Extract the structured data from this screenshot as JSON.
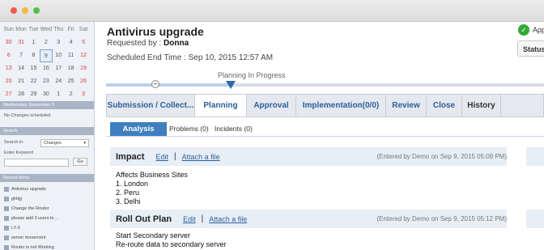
{
  "calendar": {
    "headers": [
      "Sun",
      "Mon",
      "Tue",
      "Wed",
      "Thu",
      "Fri",
      "Sat"
    ],
    "weeks": [
      [
        "30",
        "31",
        "1",
        "2",
        "3",
        "4",
        "5"
      ],
      [
        "6",
        "7",
        "8",
        "9",
        "10",
        "11",
        "12"
      ],
      [
        "13",
        "14",
        "15",
        "16",
        "17",
        "18",
        "19"
      ],
      [
        "20",
        "21",
        "22",
        "23",
        "24",
        "25",
        "26"
      ],
      [
        "27",
        "28",
        "29",
        "30",
        "1",
        "2",
        "3"
      ]
    ],
    "selected": "9"
  },
  "sidebar": {
    "date_header": "Wednesday, September 9",
    "no_changes": "No Changes scheduled",
    "search_header": "Search",
    "search_in_label": "Search in:",
    "search_in_value": "Changes",
    "keyword_label": "Enter Keyword",
    "go_label": "Go",
    "recent_header": "Recent Items",
    "recent_items": [
      "Antivirus upgrade",
      "ghhjjj",
      "Change the Router",
      "please add 3 users to ...",
      "LY-3",
      "server movement",
      "Router is not Working"
    ]
  },
  "header": {
    "title": "Antivirus upgrade",
    "requested_label": "Requested by : ",
    "requested_by": "Donna",
    "scheduled": "Scheduled End Time : Sep 10, 2015 12:57 AM",
    "approved_label": "App",
    "status_label": "Status"
  },
  "progress": {
    "label": "Planning In Progress",
    "fraction": 0.29
  },
  "tabs": [
    "Submission / Collect...",
    "Planning",
    "Approval",
    "Implementation(0/0)",
    "Review",
    "Close",
    "History"
  ],
  "subtabs": {
    "analysis": "Analysis",
    "problems": "Problems (0)",
    "incidents": "Incidents (0)"
  },
  "panels": [
    {
      "title": "Impact",
      "edit": "Edit",
      "sep": "|",
      "attach": "Attach a file",
      "meta": "(Entered by Demo on Sep 9, 2015 05:09 PM)",
      "lines": [
        "Affects Business Sites",
        "1. London",
        "2. Peru",
        "3. Delhi"
      ]
    },
    {
      "title": "Roll Out Plan",
      "edit": "Edit",
      "sep": "|",
      "attach": "Attach a file",
      "meta": "(Entered by Demo on Sep 9, 2015 05:12 PM)",
      "lines": [
        "Start Secondary server",
        "Re-route data to secondary server"
      ]
    }
  ],
  "colors": {
    "accent": "#2c5f99",
    "analysis_bg": "#3e7fbf",
    "approved": "#35a835"
  }
}
